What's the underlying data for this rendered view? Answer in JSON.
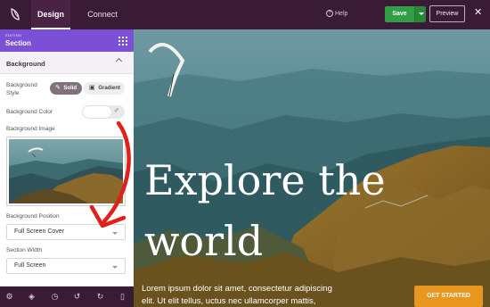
{
  "topbar": {
    "tabs": [
      {
        "label": "Design",
        "active": true
      },
      {
        "label": "Connect",
        "active": false
      }
    ],
    "help_label": "Help",
    "save_label": "Save",
    "preview_label": "Preview",
    "close_symbol": "✕"
  },
  "sidebar": {
    "editing_label": "EDITING",
    "section_title": "Section",
    "group_title": "Background",
    "background_style": {
      "label": "Background Style",
      "options": [
        {
          "label": "Solid",
          "icon": "pencil-icon",
          "selected": true
        },
        {
          "label": "Gradient",
          "icon": "image-icon",
          "selected": false
        }
      ]
    },
    "background_color_label": "Background Color",
    "background_image_label": "Background Image",
    "background_position": {
      "label": "Background Position",
      "value": "Full Screen Cover"
    },
    "section_width": {
      "label": "Section Width",
      "value": "Full Screen"
    }
  },
  "bottombar": {
    "icons": [
      "gear-icon",
      "layers-icon",
      "history-icon",
      "undo-icon",
      "redo-icon",
      "mobile-icon"
    ]
  },
  "canvas": {
    "headline_line1": "Explore the",
    "headline_line2": "world",
    "body_line1": "Lorem ipsum dolor sit amet, consectetur adipiscing",
    "body_line2": "elit. Ut elit tellus, uctus nec ullamcorper mattis,",
    "cta_label": "GET STARTED"
  },
  "colors": {
    "topbar_bg": "#3a1b35",
    "save_green": "#2f9e44",
    "section_header_purple": "#7b4fd6",
    "cta_orange": "#e8961e",
    "annotation_red": "#e0201a"
  }
}
